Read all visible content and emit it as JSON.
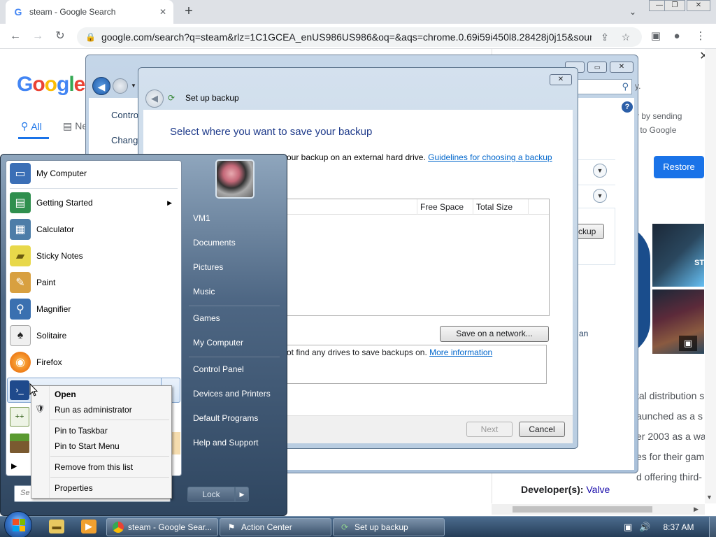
{
  "browser": {
    "tab_title": "steam - Google Search",
    "url": "google.com/search?q=steam&rlz=1C1GCEA_enUS986US986&oq=&aqs=chrome.0.69i59i450l8.28428j0j15&sour...",
    "controls": {
      "minimize": "—",
      "restore": "❐",
      "close": "✕"
    }
  },
  "google": {
    "logo": [
      "G",
      "o",
      "o",
      "g",
      "l",
      "e"
    ],
    "tab_all": "All",
    "tab_news": "Ne",
    "panel_text": [
      "ter by sending",
      "cs to Google"
    ],
    "restore_label": "Restore",
    "steam_overlay": "ST",
    "snippet": [
      "tal distribution s",
      "aunched as a s",
      "er 2003 as a wa",
      "es for their gam",
      "d offering third-"
    ],
    "developer_label": "Developer(s):",
    "developer_value": "Valve"
  },
  "control_panel": {
    "link1": "Contro",
    "link2": "Change",
    "partial_right": "y.",
    "backup_btn": "ckup",
    "an_text": "an"
  },
  "backup_dialog": {
    "title": "Set up backup",
    "heading": "Select where you want to save your backup",
    "description": "our backup on an external hard drive.",
    "guidelines_link": "Guidelines for choosing a backup",
    "col_free": "Free Space",
    "col_total": "Total Size",
    "save_network": "Save on a network...",
    "warn_text": "ot find any drives to save backups on.",
    "more_info_link": "More information",
    "next": "Next",
    "cancel": "Cancel"
  },
  "start_menu": {
    "programs": [
      {
        "label": "My Computer",
        "icon": "computer-icon",
        "color": "#3b6fb6"
      },
      {
        "label": "Getting Started",
        "icon": "getting-started-icon",
        "color": "#2f8f4e",
        "submenu": true
      },
      {
        "label": "Calculator",
        "icon": "calculator-icon",
        "color": "#4d7da8"
      },
      {
        "label": "Sticky Notes",
        "icon": "sticky-notes-icon",
        "color": "#e8d84a"
      },
      {
        "label": "Paint",
        "icon": "paint-icon",
        "color": "#d8a040"
      },
      {
        "label": "Magnifier",
        "icon": "magnifier-icon",
        "color": "#3a70b0"
      },
      {
        "label": "Solitaire",
        "icon": "solitaire-icon",
        "color": "#6a6a6a"
      },
      {
        "label": "Firefox",
        "icon": "firefox-icon",
        "color": "#e66000"
      }
    ],
    "all_programs_arrow": "▶",
    "search_placeholder": "Se",
    "right_items": [
      "VM1",
      "Documents",
      "Pictures",
      "Music",
      "Games",
      "My Computer",
      "Control Panel",
      "Devices and Printers",
      "Default Programs",
      "Help and Support"
    ],
    "lock": "Lock"
  },
  "context_menu": {
    "items": [
      "Open",
      "Run as administrator",
      "Pin to Taskbar",
      "Pin to Start Menu",
      "Remove from this list",
      "Properties"
    ]
  },
  "taskbar": {
    "tasks": [
      {
        "label": "steam - Google Sear...",
        "icon": "chrome-icon"
      },
      {
        "label": "Action Center",
        "icon": "action-center-flag-icon"
      },
      {
        "label": "Set up backup",
        "icon": "backup-icon"
      }
    ],
    "clock": "8:37 AM"
  }
}
